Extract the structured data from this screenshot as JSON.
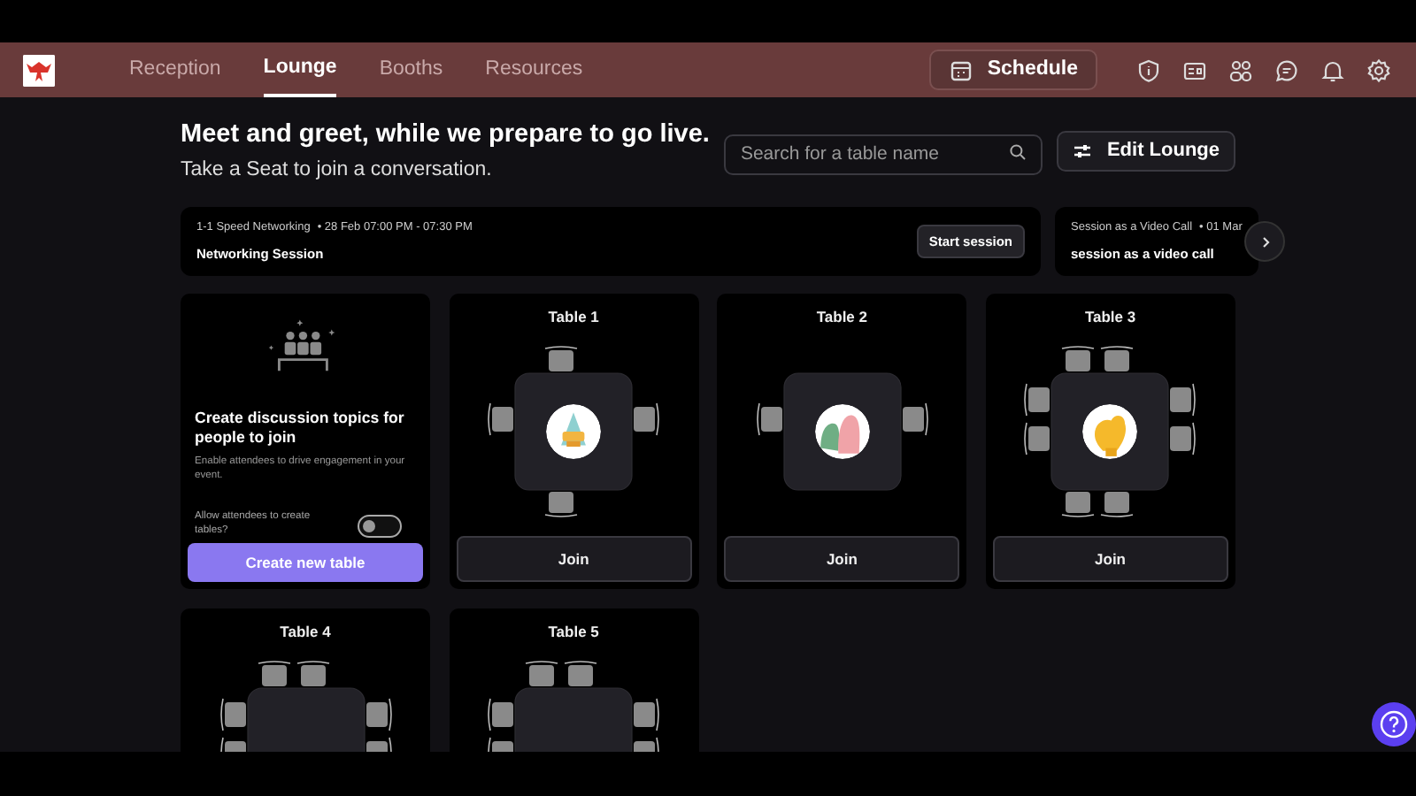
{
  "nav": {
    "tabs": [
      {
        "label": "Reception",
        "selected": false
      },
      {
        "label": "Lounge",
        "selected": true
      },
      {
        "label": "Booths",
        "selected": false
      },
      {
        "label": "Resources",
        "selected": false
      }
    ],
    "schedule_button": "Schedule"
  },
  "intro": {
    "title": "Meet and greet, while we prepare to go live.",
    "subtitle": "Take a Seat to join a conversation."
  },
  "search": {
    "placeholder": "Search for a table name"
  },
  "edit_button": "Edit Lounge",
  "sessions": [
    {
      "type": "1-1 Speed Networking",
      "date": "• 28 Feb 07:00 PM - 07:30 PM",
      "title": "Networking Session",
      "action": "Start session"
    },
    {
      "type": "Session as a Video Call",
      "date": "• 01 Mar",
      "title": "session as a video call"
    }
  ],
  "create_card": {
    "title": "Create discussion topics for people to join",
    "description": "Enable attendees to drive engagement in your event.",
    "toggle_label": "Allow attendees to create tables?",
    "toggle_on": false,
    "button": "Create new table"
  },
  "tables": [
    {
      "name": "Table 1",
      "kind": "four",
      "button": "Join"
    },
    {
      "name": "Table 2",
      "kind": "two",
      "button": "Join"
    },
    {
      "name": "Table 3",
      "kind": "eight",
      "button": "Join"
    },
    {
      "name": "Table 4",
      "kind": "eight"
    },
    {
      "name": "Table 5",
      "kind": "eight"
    }
  ]
}
